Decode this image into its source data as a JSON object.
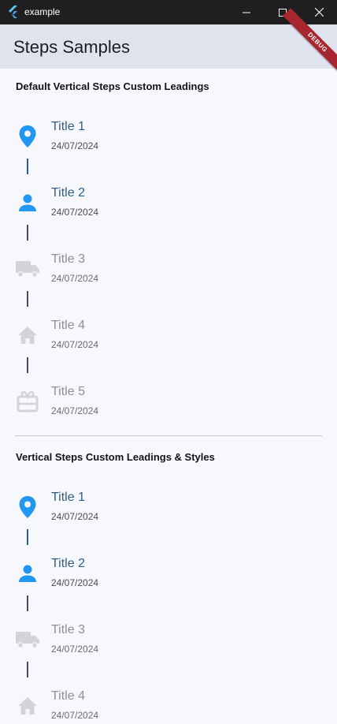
{
  "window": {
    "title": "example"
  },
  "appbar": {
    "title": "Steps Samples",
    "debug_label": "DEBUG"
  },
  "colors": {
    "active_icon": "#2196f3",
    "inactive_icon": "#d3d4d8",
    "active_title": "#2f5d8a",
    "debug": "#a8262f"
  },
  "section1": {
    "title": "Default Vertical Steps Custom Leadings",
    "steps": [
      {
        "title": "Title 1",
        "date": "24/07/2024",
        "icon": "location-pin-icon",
        "active": true
      },
      {
        "title": "Title 2",
        "date": "24/07/2024",
        "icon": "person-icon",
        "active": true
      },
      {
        "title": "Title 3",
        "date": "24/07/2024",
        "icon": "truck-icon",
        "active": false
      },
      {
        "title": "Title 4",
        "date": "24/07/2024",
        "icon": "house-icon",
        "active": false
      },
      {
        "title": "Title 5",
        "date": "24/07/2024",
        "icon": "gift-icon",
        "active": false
      }
    ]
  },
  "section2": {
    "title": "Vertical Steps Custom Leadings & Styles",
    "steps": [
      {
        "title": "Title 1",
        "date": "24/07/2024",
        "icon": "location-pin-icon",
        "active": true
      },
      {
        "title": "Title 2",
        "date": "24/07/2024",
        "icon": "person-icon",
        "active": true
      },
      {
        "title": "Title 3",
        "date": "24/07/2024",
        "icon": "truck-icon",
        "active": false
      },
      {
        "title": "Title 4",
        "date": "24/07/2024",
        "icon": "house-icon",
        "active": false
      }
    ]
  }
}
